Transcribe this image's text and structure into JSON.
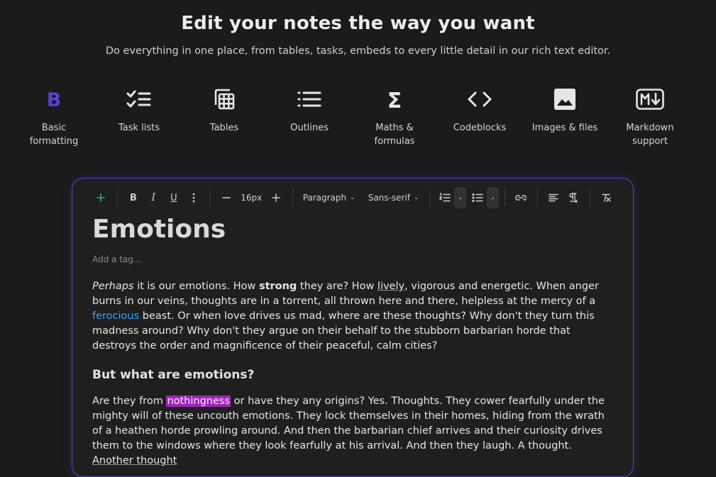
{
  "hero": {
    "title": "Edit your notes the way you want",
    "subtitle": "Do everything in one place, from tables, tasks, embeds to every little detail in our rich text editor."
  },
  "features": [
    {
      "label": "Basic\nformatting",
      "icon": "bold-icon",
      "color": "#5b3fd1"
    },
    {
      "label": "Task lists",
      "icon": "checklist-icon"
    },
    {
      "label": "Tables",
      "icon": "table-icon"
    },
    {
      "label": "Outlines",
      "icon": "outline-list-icon"
    },
    {
      "label": "Maths &\nformulas",
      "icon": "sigma-icon"
    },
    {
      "label": "Codeblocks",
      "icon": "code-icon"
    },
    {
      "label": "Images & files",
      "icon": "image-icon"
    },
    {
      "label": "Markdown\nsupport",
      "icon": "markdown-icon"
    }
  ],
  "toolbar": {
    "font_size": "16px",
    "block_type": "Paragraph",
    "font_family": "Sans-serif"
  },
  "document": {
    "title": "Emotions",
    "tag_placeholder": "Add a tag...",
    "p1": {
      "italic": "Perhaps",
      "t1": " it is our emotions. How ",
      "bold": "strong",
      "t2": " they are? How ",
      "underline": "lively",
      "t3": ", vigorous and energetic. When anger burns in our veins, thoughts are in a torrent, all thrown here and there, helpless at the mercy of a ",
      "link": "ferocious",
      "t4": " beast. Or when love drives us mad, where are these thoughts? Why don't they turn this madness around? Why don't they argue on their behalf to the stubborn barbarian horde that destroys the order and magnificence of their peaceful, calm cities?"
    },
    "heading": "But what are emotions?",
    "p2": {
      "t1": "Are they from ",
      "highlight": "nothingness",
      "t2": " or have they any origins? Yes. Thoughts. They cower fearfully under the mighty will of these uncouth emotions. They lock themselves in their homes, hiding from the wrath of a heathen horde prowling around. And then the barbarian chief arrives and their curiosity drives them to the windows where they look fearfully at his arrival. And then they laugh. A thought. ",
      "underline": "Another thought"
    }
  },
  "colors": {
    "accent": "#5b43c9",
    "add": "#2bb673",
    "link": "#2ea1ff",
    "highlight": "#9b28b6"
  }
}
